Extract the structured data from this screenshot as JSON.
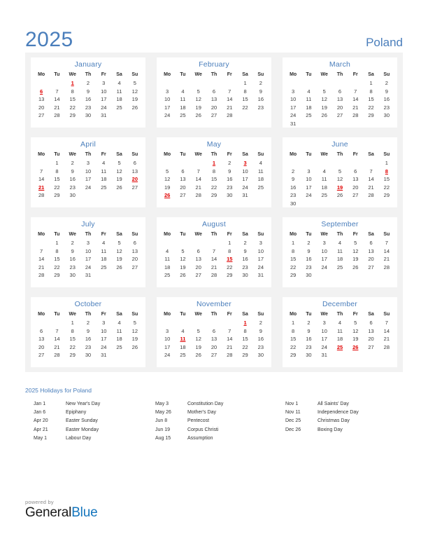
{
  "header": {
    "year": "2025",
    "country": "Poland"
  },
  "weekdays": [
    "Mo",
    "Tu",
    "We",
    "Th",
    "Fr",
    "Sa",
    "Su"
  ],
  "months": [
    {
      "name": "January",
      "lead_blanks": 2,
      "days": 31,
      "holidays": [
        1,
        6
      ]
    },
    {
      "name": "February",
      "lead_blanks": 5,
      "days": 28,
      "holidays": []
    },
    {
      "name": "March",
      "lead_blanks": 5,
      "days": 31,
      "holidays": []
    },
    {
      "name": "April",
      "lead_blanks": 1,
      "days": 30,
      "holidays": [
        20,
        21
      ]
    },
    {
      "name": "May",
      "lead_blanks": 3,
      "days": 31,
      "holidays": [
        1,
        3,
        26
      ]
    },
    {
      "name": "June",
      "lead_blanks": 6,
      "days": 30,
      "holidays": [
        8,
        19
      ]
    },
    {
      "name": "July",
      "lead_blanks": 1,
      "days": 31,
      "holidays": []
    },
    {
      "name": "August",
      "lead_blanks": 4,
      "days": 31,
      "holidays": [
        15
      ]
    },
    {
      "name": "September",
      "lead_blanks": 0,
      "days": 30,
      "holidays": []
    },
    {
      "name": "October",
      "lead_blanks": 2,
      "days": 31,
      "holidays": []
    },
    {
      "name": "November",
      "lead_blanks": 5,
      "days": 30,
      "holidays": [
        1,
        11
      ]
    },
    {
      "name": "December",
      "lead_blanks": 0,
      "days": 31,
      "holidays": [
        25,
        26
      ]
    }
  ],
  "holidays_section": {
    "title": "2025 Holidays for Poland",
    "columns": [
      [
        {
          "date": "Jan 1",
          "name": "New Year's Day"
        },
        {
          "date": "Jan 6",
          "name": "Epiphany"
        },
        {
          "date": "Apr 20",
          "name": "Easter Sunday"
        },
        {
          "date": "Apr 21",
          "name": "Easter Monday"
        },
        {
          "date": "May 1",
          "name": "Labour Day"
        }
      ],
      [
        {
          "date": "May 3",
          "name": "Constitution Day"
        },
        {
          "date": "May 26",
          "name": "Mother's Day"
        },
        {
          "date": "Jun 8",
          "name": "Pentecost"
        },
        {
          "date": "Jun 19",
          "name": "Corpus Christi"
        },
        {
          "date": "Aug 15",
          "name": "Assumption"
        }
      ],
      [
        {
          "date": "Nov 1",
          "name": "All Saints' Day"
        },
        {
          "date": "Nov 11",
          "name": "Independence Day"
        },
        {
          "date": "Dec 25",
          "name": "Christmas Day"
        },
        {
          "date": "Dec 26",
          "name": "Boxing Day"
        }
      ]
    ]
  },
  "footer": {
    "powered_by": "powered by",
    "brand_first": "General",
    "brand_second": "Blue"
  },
  "colors": {
    "accent_blue": "#4a7ebb",
    "holiday_red": "#e00000",
    "panel_bg": "#f2f2f2",
    "brand_blue": "#1576bd"
  }
}
